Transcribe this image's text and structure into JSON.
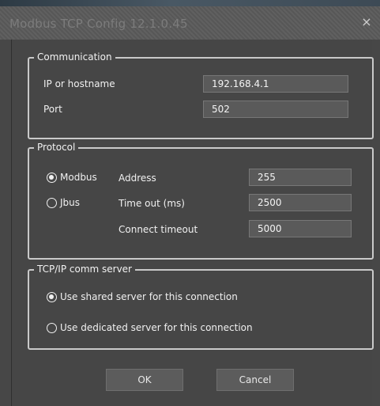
{
  "window": {
    "title": "Modbus TCP Config 12.1.0.45",
    "close_glyph": "×"
  },
  "communication": {
    "legend": "Communication",
    "ip_label": "IP or hostname",
    "ip_value": "192.168.4.1",
    "port_label": "Port",
    "port_value": "502"
  },
  "protocol": {
    "legend": "Protocol",
    "options": [
      {
        "label": "Modbus",
        "selected": true
      },
      {
        "label": "Jbus",
        "selected": false
      }
    ],
    "address_label": "Address",
    "address_value": "255",
    "timeout_label": "Time out (ms)",
    "timeout_value": "2500",
    "connect_timeout_label": "Connect timeout",
    "connect_timeout_value": "5000"
  },
  "server": {
    "legend": "TCP/IP comm server",
    "options": [
      {
        "label": "Use shared server for this connection",
        "selected": true
      },
      {
        "label": "Use dedicated server for this connection",
        "selected": false
      }
    ]
  },
  "buttons": {
    "ok": "OK",
    "cancel": "Cancel"
  },
  "colors": {
    "dialog_bg": "#474747",
    "titlebar_bg": "#5a5a5a",
    "group_border": "#c9c9c9",
    "text": "#f0f0f0",
    "field_bg": "#5a5a5a"
  }
}
